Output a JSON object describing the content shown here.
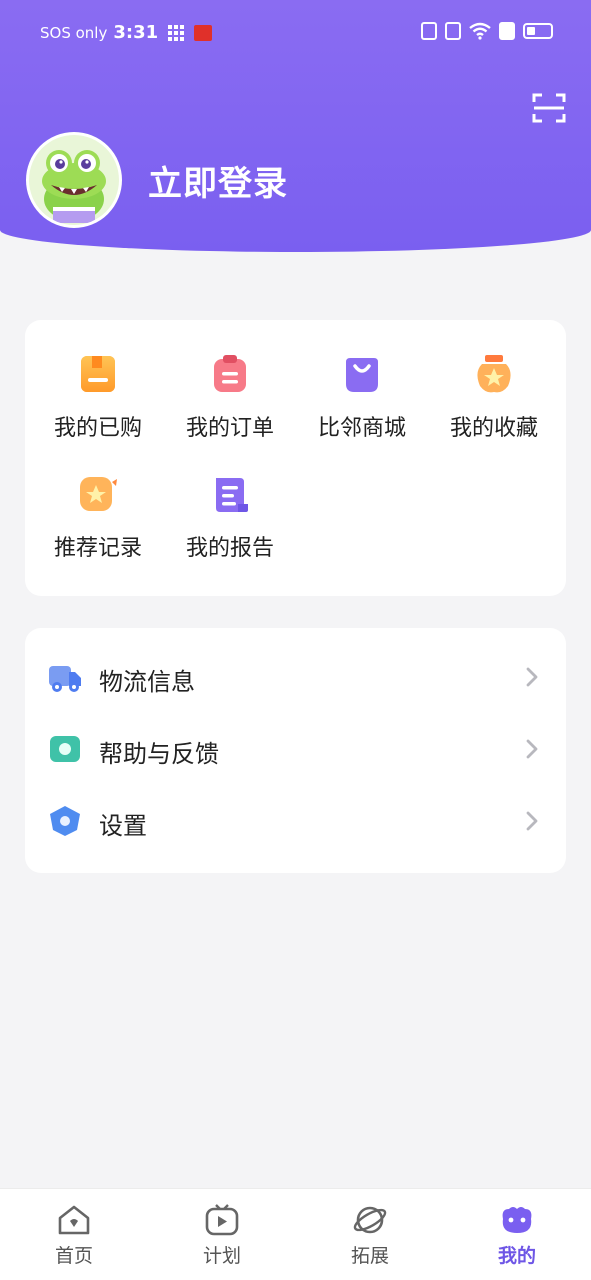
{
  "status_bar": {
    "carrier": "SOS only",
    "time": "3:31"
  },
  "header": {
    "login_label": "立即登录"
  },
  "quick_grid": {
    "items": [
      {
        "label": "我的已购",
        "icon": "purchased-icon"
      },
      {
        "label": "我的订单",
        "icon": "orders-icon"
      },
      {
        "label": "比邻商城",
        "icon": "shop-icon"
      },
      {
        "label": "我的收藏",
        "icon": "favorites-icon"
      },
      {
        "label": "推荐记录",
        "icon": "recommend-icon"
      },
      {
        "label": "我的报告",
        "icon": "report-icon"
      }
    ]
  },
  "menu_list": {
    "items": [
      {
        "label": "物流信息",
        "icon": "truck-icon"
      },
      {
        "label": "帮助与反馈",
        "icon": "help-icon"
      },
      {
        "label": "设置",
        "icon": "settings-icon"
      }
    ]
  },
  "bottom_nav": {
    "items": [
      {
        "label": "首页",
        "icon": "home-icon",
        "active": false
      },
      {
        "label": "计划",
        "icon": "plan-icon",
        "active": false
      },
      {
        "label": "拓展",
        "icon": "explore-icon",
        "active": false
      },
      {
        "label": "我的",
        "icon": "mine-icon",
        "active": true
      }
    ]
  },
  "colors": {
    "header": "#7a5ff0",
    "accent": "#6e56e6",
    "background": "#f4f4f6"
  }
}
